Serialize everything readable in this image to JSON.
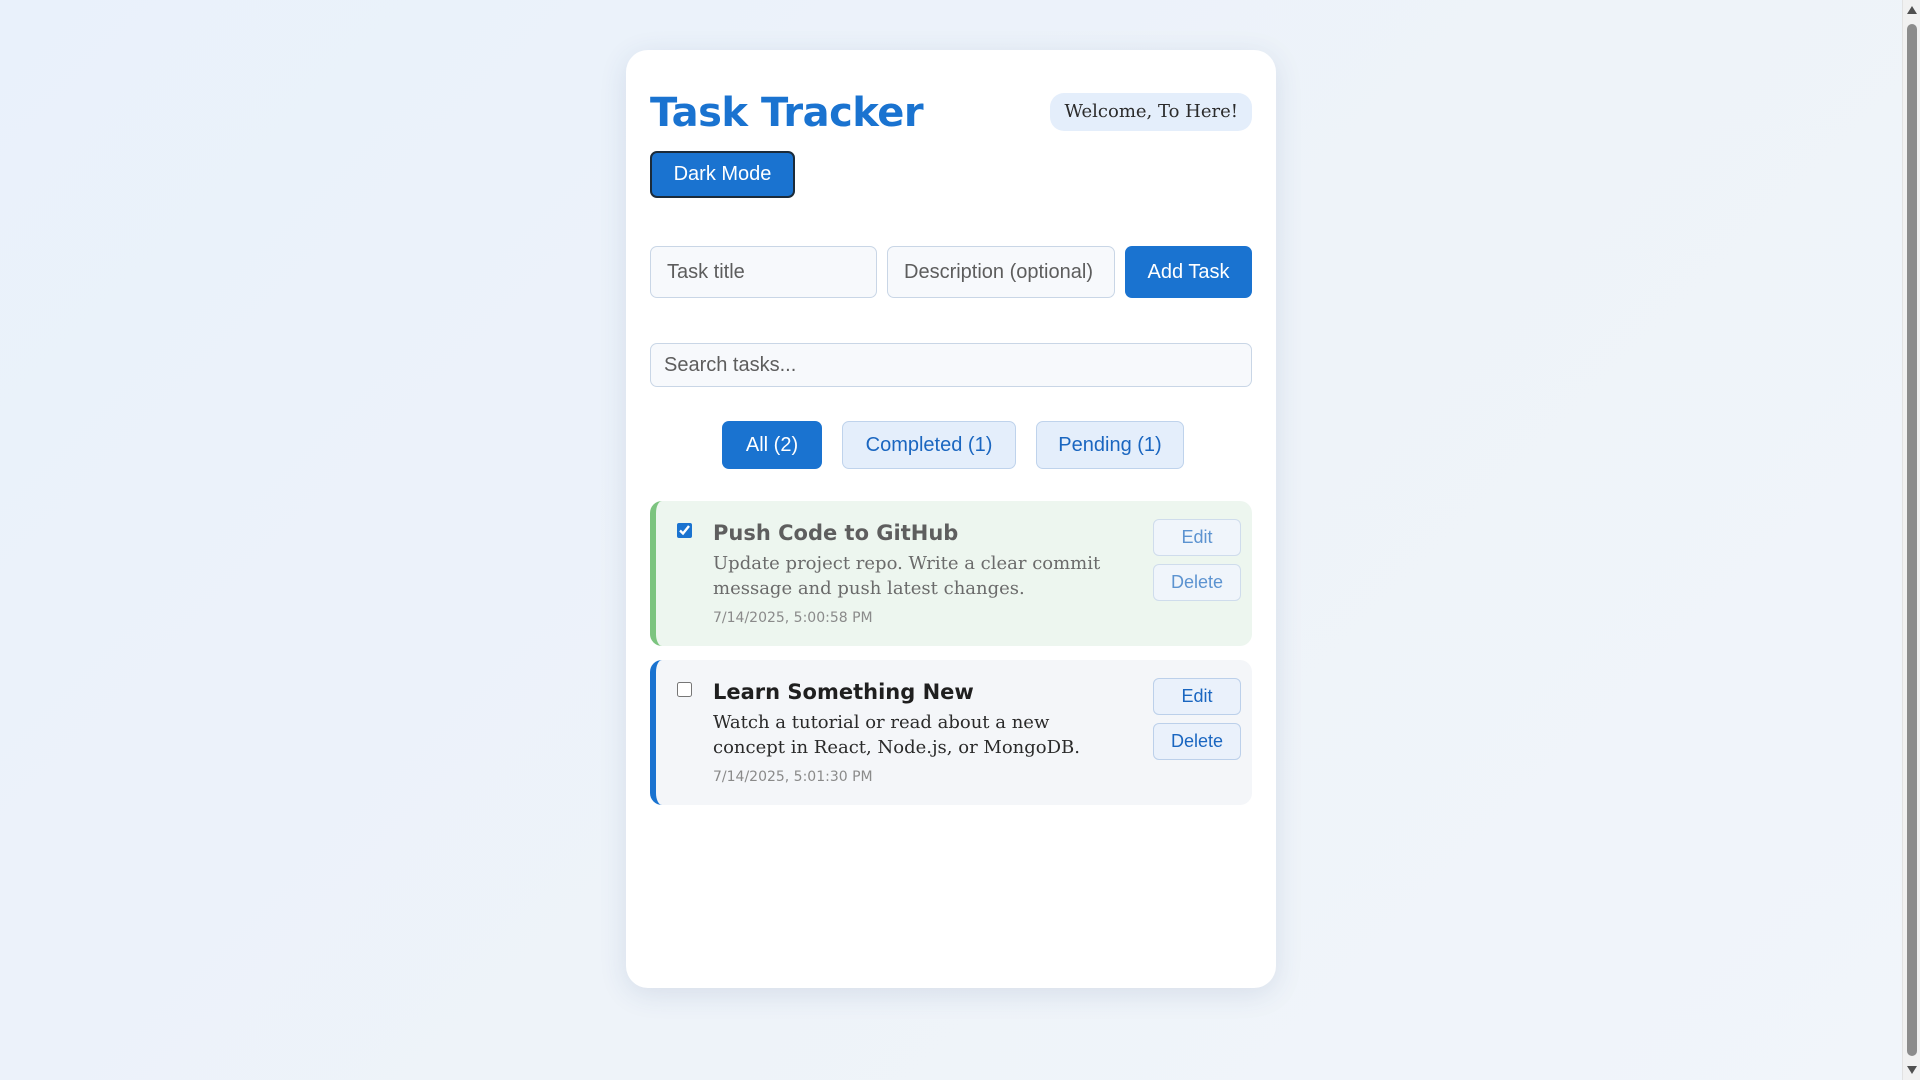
{
  "header": {
    "title": "Task Tracker",
    "welcome": "Welcome, To Here!",
    "dark_mode_label": "Dark Mode"
  },
  "add_task": {
    "title_placeholder": "Task title",
    "description_placeholder": "Description (optional)",
    "add_label": "Add Task"
  },
  "search": {
    "placeholder": "Search tasks..."
  },
  "filters": [
    {
      "label": "All (2)",
      "active": true
    },
    {
      "label": "Completed (1)",
      "active": false
    },
    {
      "label": "Pending (1)",
      "active": false
    }
  ],
  "tasks": [
    {
      "title": "Push Code to GitHub",
      "description": "Update project repo. Write a clear commit message and push latest changes.",
      "timestamp": "7/14/2025, 5:00:58 PM",
      "completed": true,
      "edit_label": "Edit",
      "delete_label": "Delete"
    },
    {
      "title": "Learn Something New",
      "description": "Watch a tutorial or read about a new concept in React, Node.js, or MongoDB.",
      "timestamp": "7/14/2025, 5:01:30 PM",
      "completed": false,
      "edit_label": "Edit",
      "delete_label": "Delete"
    }
  ],
  "colors": {
    "accent": "#1a73d0",
    "completed_border": "#7cc47f",
    "completed_bg": "#edf6ef",
    "pending_bg": "#f4f6f9"
  }
}
